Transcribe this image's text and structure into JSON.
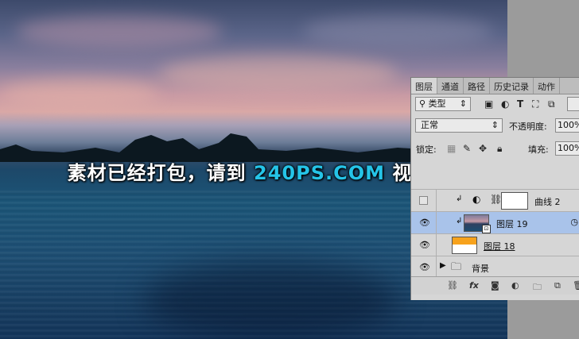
{
  "banner": {
    "prefix": "素材已经打包，请到 ",
    "highlight": "240PS.COM",
    "suffix": " 视频教程下载",
    "highlight_color": "#25c4e8"
  },
  "panel": {
    "tabs": [
      "图层",
      "通道",
      "路径",
      "历史记录",
      "动作"
    ],
    "filter": {
      "label": "类型",
      "icons": [
        "image-icon",
        "adjust-icon",
        "text-icon",
        "shape-icon",
        "smart-icon"
      ]
    },
    "blend": {
      "mode": "正常",
      "opacity_label": "不透明度:",
      "opacity_value": "100%"
    },
    "lock": {
      "label": "锁定:",
      "fill_label": "填充:",
      "fill_value": "100%"
    },
    "layers": [
      {
        "name": "曲线 2",
        "visible": false,
        "type": "adjustment"
      },
      {
        "name": "图层 19",
        "visible": true,
        "type": "smart",
        "selected": true
      },
      {
        "name": "图层 18",
        "visible": true,
        "type": "pixel"
      },
      {
        "name": "背景",
        "visible": true,
        "type": "group"
      }
    ],
    "bottom_icons": [
      "link-icon",
      "fx-icon",
      "mask-icon",
      "adjustment-layer-icon",
      "folder-icon",
      "new-layer-icon",
      "trash-icon"
    ],
    "fx_label": "fx"
  }
}
